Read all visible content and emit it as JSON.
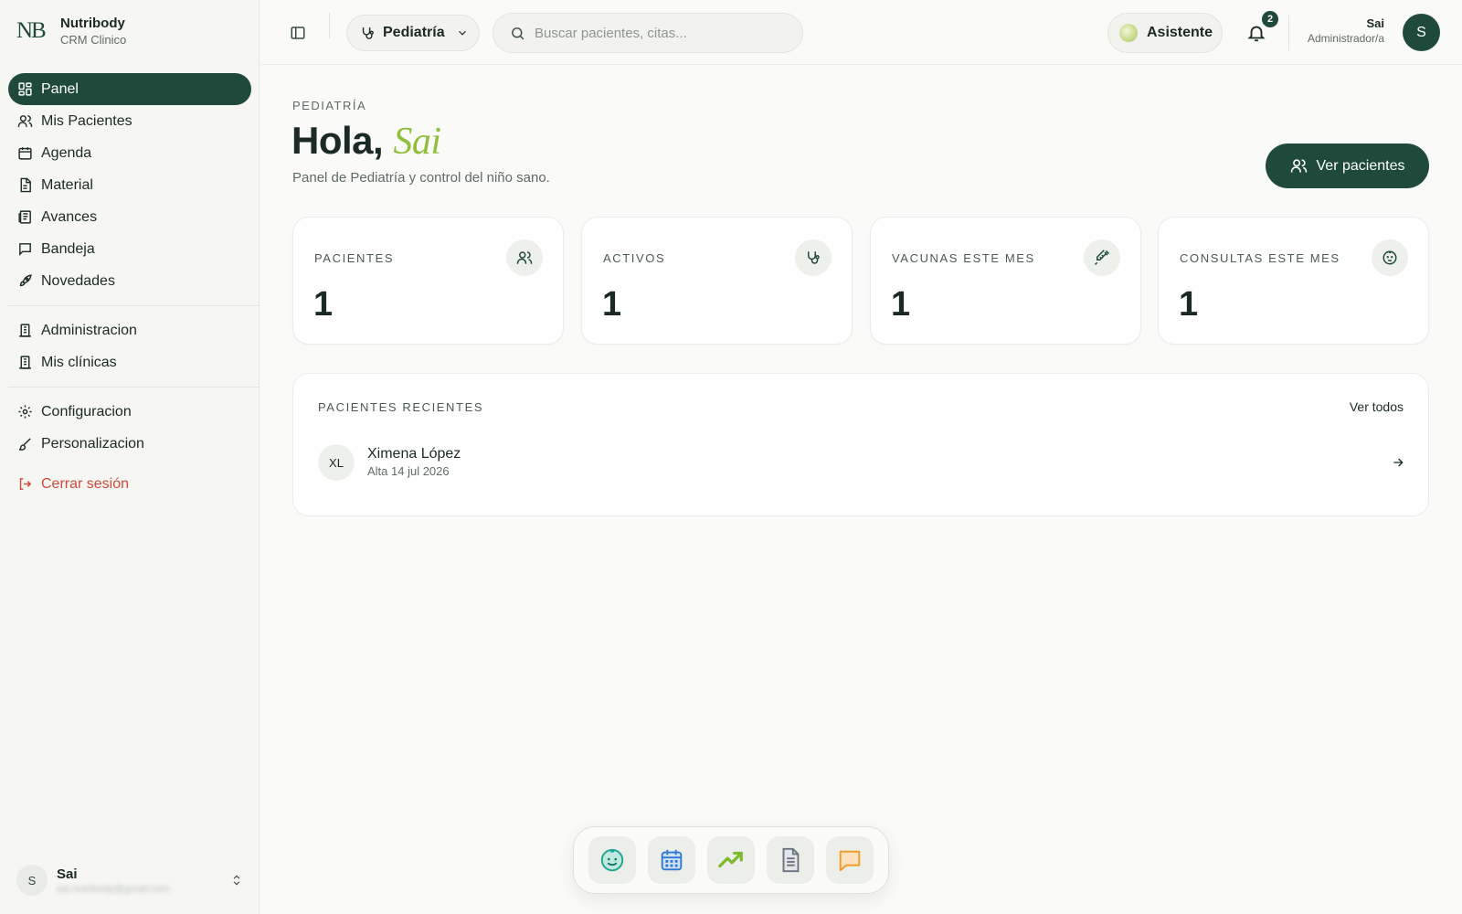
{
  "brand": {
    "logo": "NB",
    "name": "Nutribody",
    "subtitle": "CRM Clinico"
  },
  "sidebar": {
    "items": [
      {
        "label": "Panel",
        "icon": "dashboard-icon",
        "active": true
      },
      {
        "label": "Mis Pacientes",
        "icon": "users-icon"
      },
      {
        "label": "Agenda",
        "icon": "calendar-icon"
      },
      {
        "label": "Material",
        "icon": "document-icon"
      },
      {
        "label": "Avances",
        "icon": "book-icon"
      },
      {
        "label": "Bandeja",
        "icon": "chat-icon"
      },
      {
        "label": "Novedades",
        "icon": "rocket-icon"
      }
    ],
    "admin_items": [
      {
        "label": "Administracion",
        "icon": "building-icon"
      },
      {
        "label": "Mis clínicas",
        "icon": "building-icon"
      }
    ],
    "settings_items": [
      {
        "label": "Configuracion",
        "icon": "gear-icon"
      },
      {
        "label": "Personalizacion",
        "icon": "brush-icon"
      }
    ],
    "logout": "Cerrar sesión",
    "user": {
      "initial": "S",
      "name": "Sai",
      "email": "sai.nutribody@gmail.com"
    }
  },
  "topbar": {
    "specialty": "Pediatría",
    "search_placeholder": "Buscar pacientes, citas...",
    "assistant": "Asistente",
    "notifications": "2",
    "user_name": "Sai",
    "user_role": "Administrador/a",
    "user_initial": "S"
  },
  "main": {
    "eyebrow": "PEDIATRÍA",
    "greeting": "Hola,",
    "greeting_name": "Sai",
    "subtitle": "Panel de Pediatría y control del niño sano.",
    "cta": "Ver pacientes",
    "stats": [
      {
        "label": "PACIENTES",
        "value": "1",
        "icon": "users-icon"
      },
      {
        "label": "ACTIVOS",
        "value": "1",
        "icon": "stethoscope-icon"
      },
      {
        "label": "VACUNAS ESTE MES",
        "value": "1",
        "icon": "syringe-icon"
      },
      {
        "label": "CONSULTAS ESTE MES",
        "value": "1",
        "icon": "baby-face-icon"
      }
    ],
    "recent": {
      "title": "PACIENTES RECIENTES",
      "view_all": "Ver todos",
      "patients": [
        {
          "initials": "XL",
          "name": "Ximena López",
          "meta": "Alta 14 jul 2026"
        }
      ]
    }
  },
  "dock": [
    "baby-face-icon",
    "calendar-icon",
    "trending-up-icon",
    "document-icon",
    "chat-icon"
  ],
  "colors": {
    "primary": "#1f4a3b",
    "accent": "#8fbf3c",
    "danger": "#d04a3a",
    "background": "#fafaf8"
  }
}
